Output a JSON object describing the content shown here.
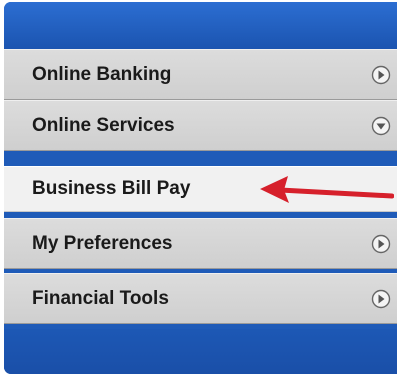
{
  "menu": {
    "items": [
      {
        "label": "Online Banking",
        "icon": "chevron-right-circle-icon"
      },
      {
        "label": "Online Services",
        "icon": "chevron-down-circle-icon"
      },
      {
        "label": "Business Bill Pay"
      },
      {
        "label": "My Preferences",
        "icon": "chevron-right-circle-icon"
      },
      {
        "label": "Financial Tools",
        "icon": "chevron-right-circle-icon"
      }
    ]
  },
  "colors": {
    "brand_blue": "#1f5bb8",
    "arrow_red": "#d6202b",
    "menu_gray": "#d5d5d5"
  }
}
